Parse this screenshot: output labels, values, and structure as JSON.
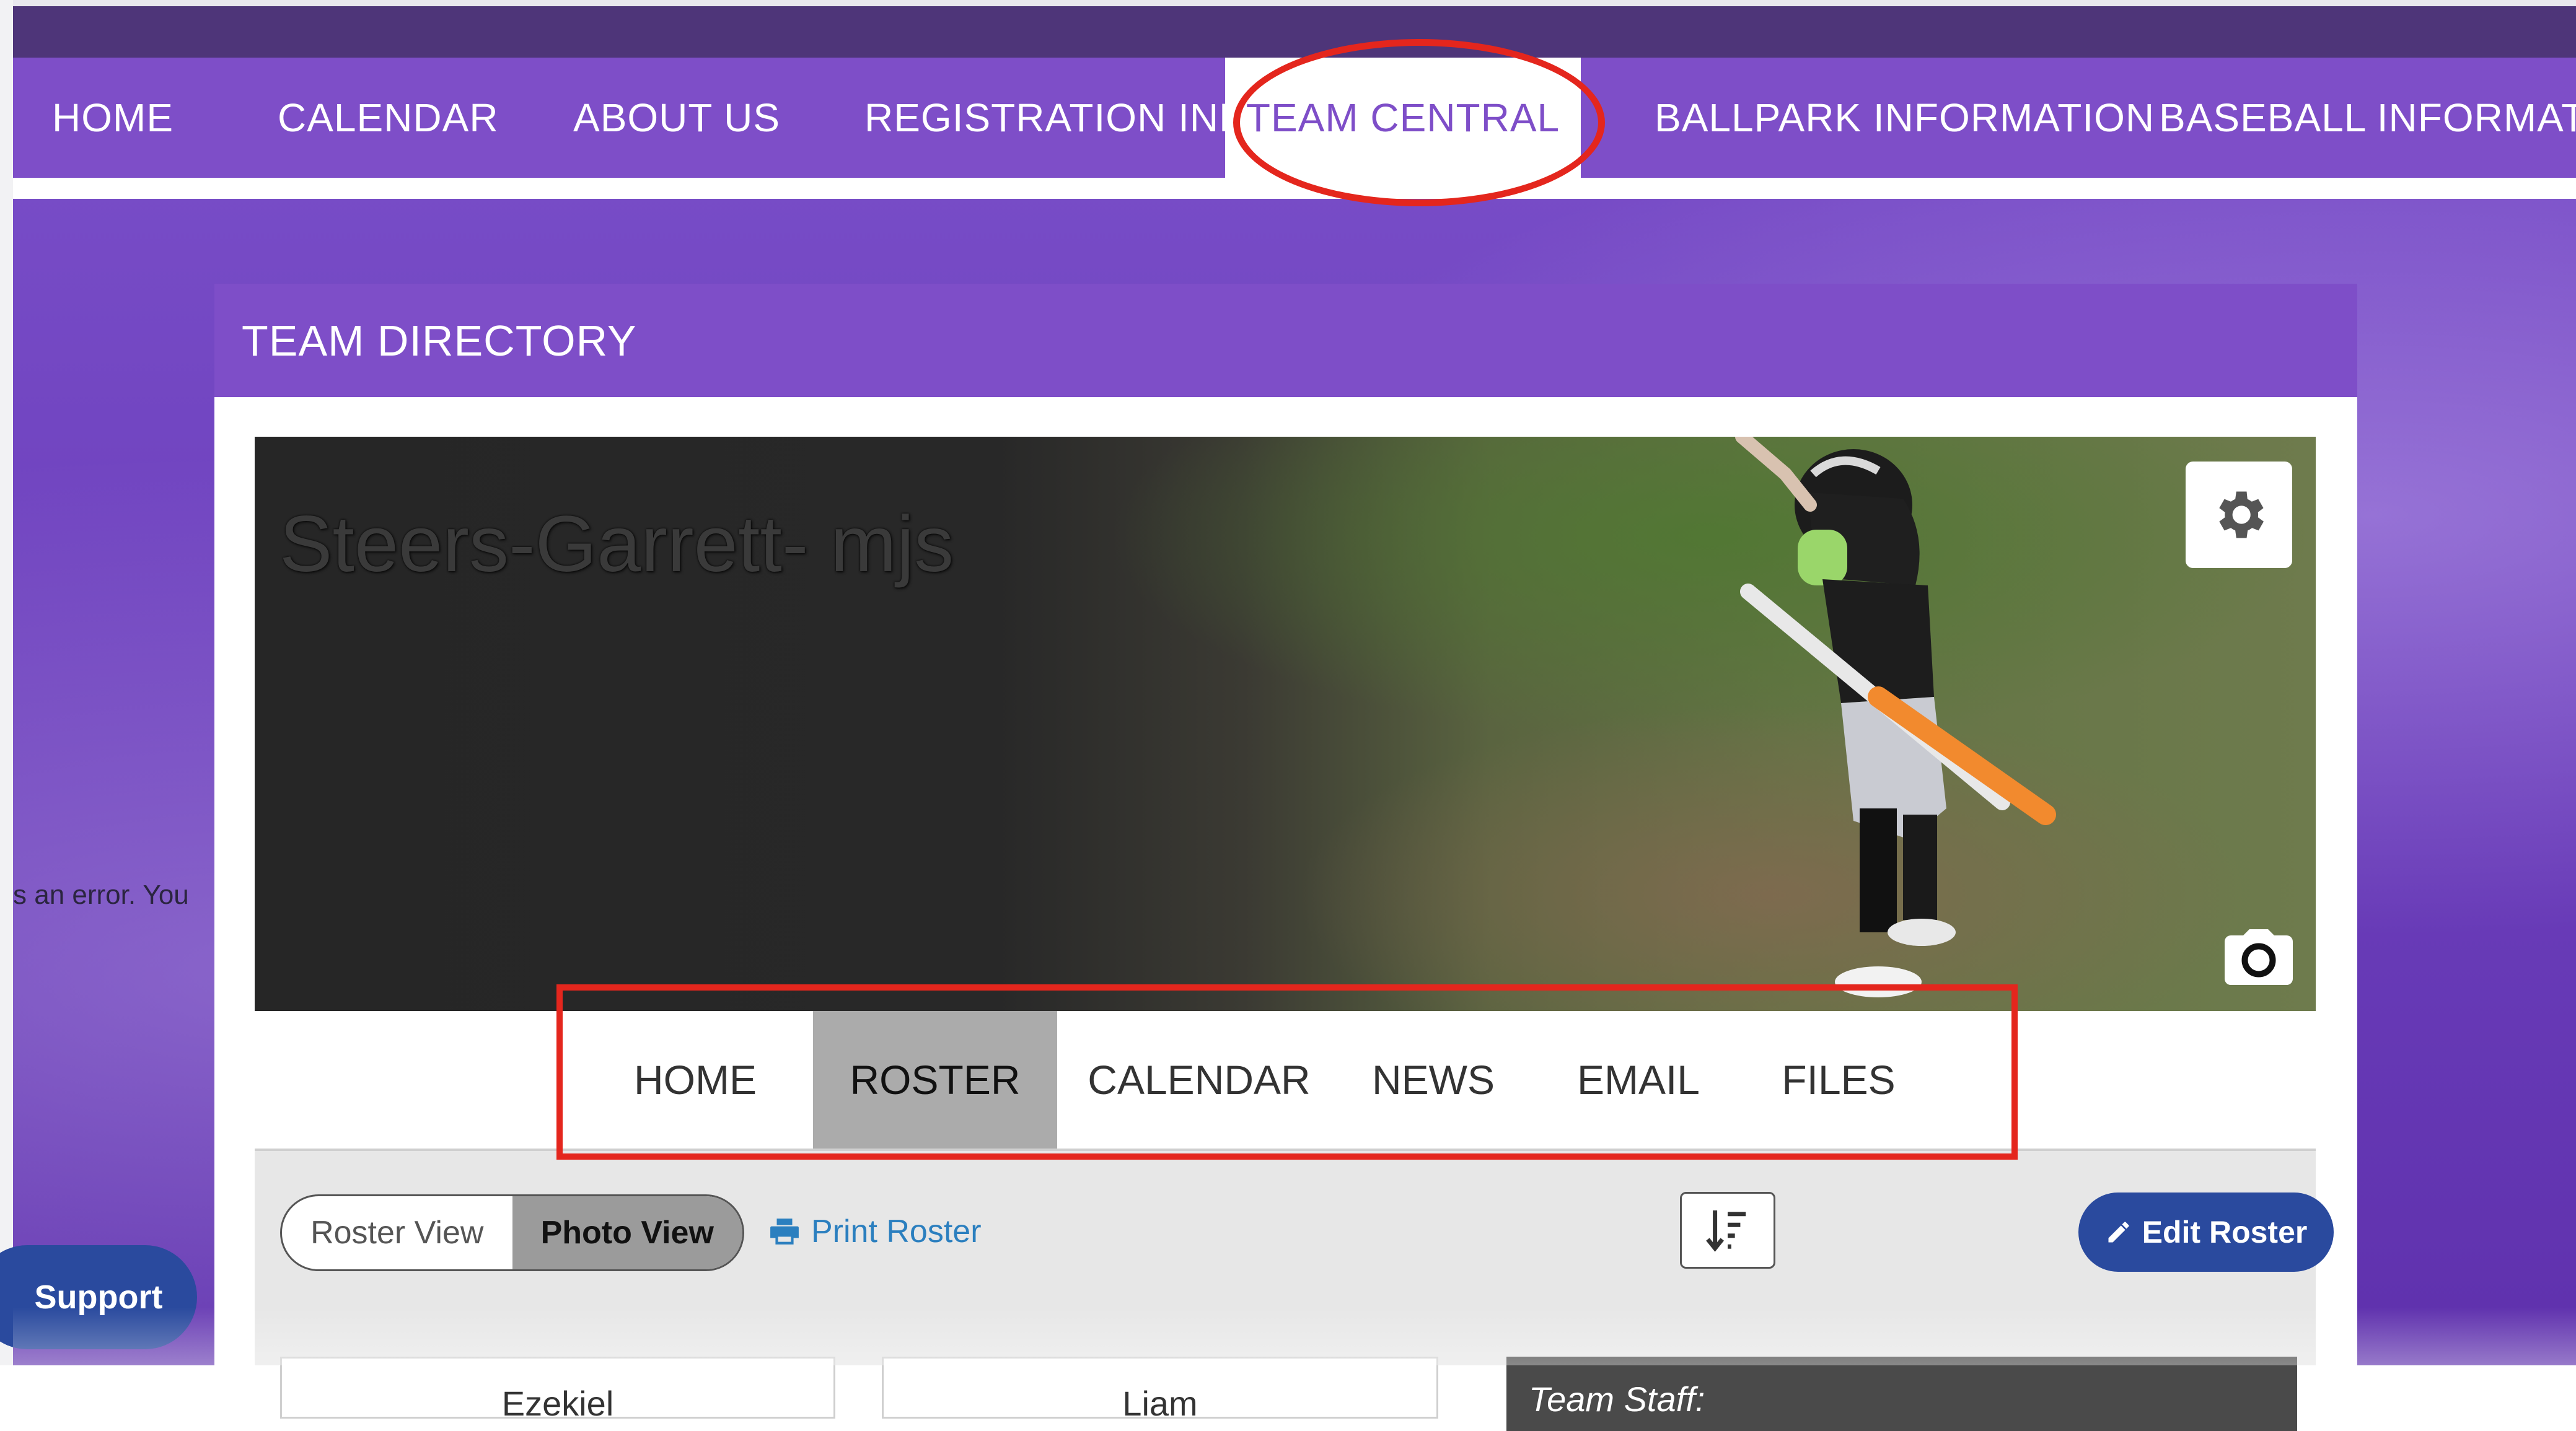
{
  "main_nav": {
    "items": [
      {
        "label": "HOME"
      },
      {
        "label": "CALENDAR"
      },
      {
        "label": "ABOUT US"
      },
      {
        "label": "REGISTRATION INFO"
      },
      {
        "label": "TEAM CENTRAL",
        "active": true
      },
      {
        "label": "BALLPARK INFORMATION"
      },
      {
        "label": "BASEBALL INFORMATION"
      }
    ]
  },
  "background_snippet": "s an error. You",
  "support_button": "Support",
  "card": {
    "header": "TEAM DIRECTORY",
    "team_name": "Steers-Garrett- mjs"
  },
  "team_nav": {
    "items": [
      {
        "label": "HOME"
      },
      {
        "label": "ROSTER",
        "active": true
      },
      {
        "label": "CALENDAR"
      },
      {
        "label": "NEWS"
      },
      {
        "label": "EMAIL"
      },
      {
        "label": "FILES"
      }
    ]
  },
  "roster_toolbar": {
    "view_toggle": [
      "Roster View",
      "Photo View"
    ],
    "active_view": "Photo View",
    "print_label": "Print Roster",
    "edit_label": "Edit Roster"
  },
  "roster_cards": [
    "Ezekiel",
    "Liam"
  ],
  "staff_heading": "Team Staff:",
  "colors": {
    "nav_purple": "#7e4ec8",
    "top_bar": "#4e3579",
    "button_blue": "#2a4a9e",
    "annotation_red": "#e4261d",
    "link_blue": "#2b7fbf"
  }
}
